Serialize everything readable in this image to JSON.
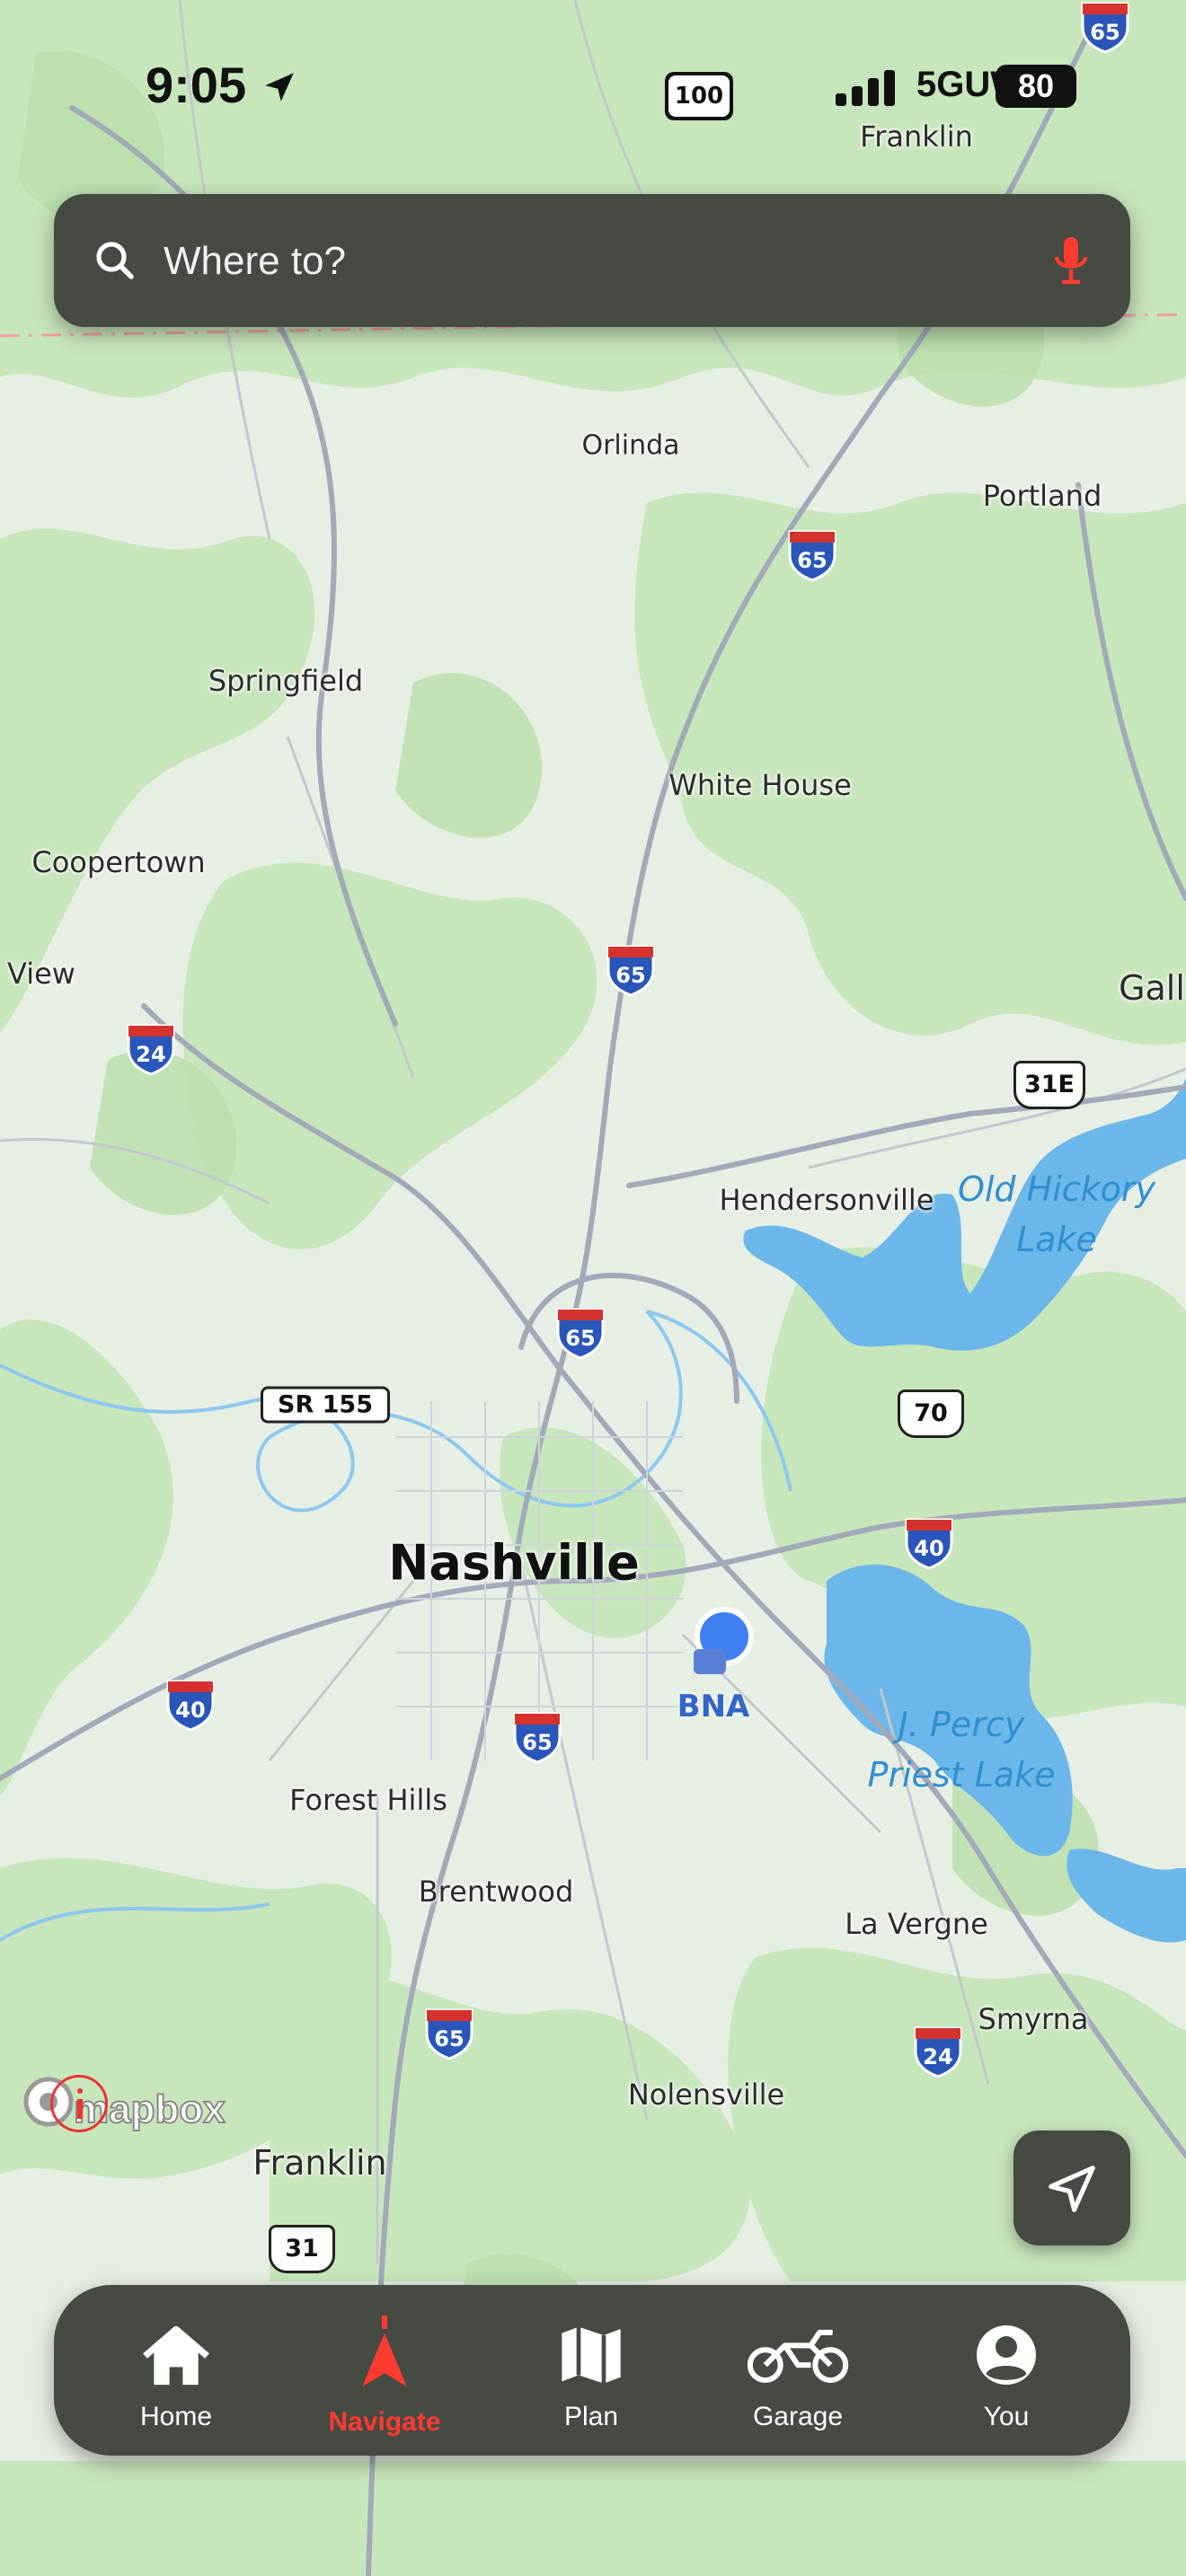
{
  "status_bar": {
    "time": "9:05",
    "network": "5GUW",
    "battery": "80"
  },
  "search": {
    "placeholder": "Where to?"
  },
  "map": {
    "places": [
      {
        "id": "franklin-ky",
        "name": "Franklin"
      },
      {
        "id": "orlinda",
        "name": "Orlinda"
      },
      {
        "id": "portland",
        "name": "Portland"
      },
      {
        "id": "springfield",
        "name": "Springfield"
      },
      {
        "id": "white-house",
        "name": "White House"
      },
      {
        "id": "coopertown",
        "name": "Coopertown"
      },
      {
        "id": "view",
        "name": "View"
      },
      {
        "id": "gall",
        "name": "Gall"
      },
      {
        "id": "hendersonville",
        "name": "Hendersonville"
      },
      {
        "id": "nashville",
        "name": "Nashville"
      },
      {
        "id": "forest-hills",
        "name": "Forest Hills"
      },
      {
        "id": "brentwood",
        "name": "Brentwood"
      },
      {
        "id": "la-vergne",
        "name": "La Vergne"
      },
      {
        "id": "smyrna",
        "name": "Smyrna"
      },
      {
        "id": "nolensville",
        "name": "Nolensville"
      },
      {
        "id": "franklin-tn",
        "name": "Franklin"
      }
    ],
    "water": [
      {
        "id": "old-hickory",
        "line1": "Old Hickory",
        "line2": "Lake"
      },
      {
        "id": "percy-priest",
        "line1": "J. Percy",
        "line2": "Priest Lake"
      }
    ],
    "airport": "BNA",
    "interstates": [
      "65",
      "65",
      "65",
      "65",
      "65",
      "65",
      "24",
      "24",
      "40",
      "40"
    ],
    "us_routes": [
      "31E",
      "70",
      "31"
    ],
    "state_routes": [
      "SR 155"
    ],
    "state_badge": "100",
    "attribution": "mapbox"
  },
  "tabs": [
    {
      "id": "home",
      "label": "Home",
      "icon": "home-icon"
    },
    {
      "id": "navigate",
      "label": "Navigate",
      "icon": "navigate-icon",
      "active": true
    },
    {
      "id": "plan",
      "label": "Plan",
      "icon": "map-icon"
    },
    {
      "id": "garage",
      "label": "Garage",
      "icon": "motorcycle-icon"
    },
    {
      "id": "you",
      "label": "You",
      "icon": "user-icon"
    }
  ],
  "colors": {
    "accent": "#ff3b30",
    "panel": "#454a43",
    "user_dot": "#3f7ff2",
    "water": "#4da9e6",
    "land_green": "#c5e6b8"
  }
}
